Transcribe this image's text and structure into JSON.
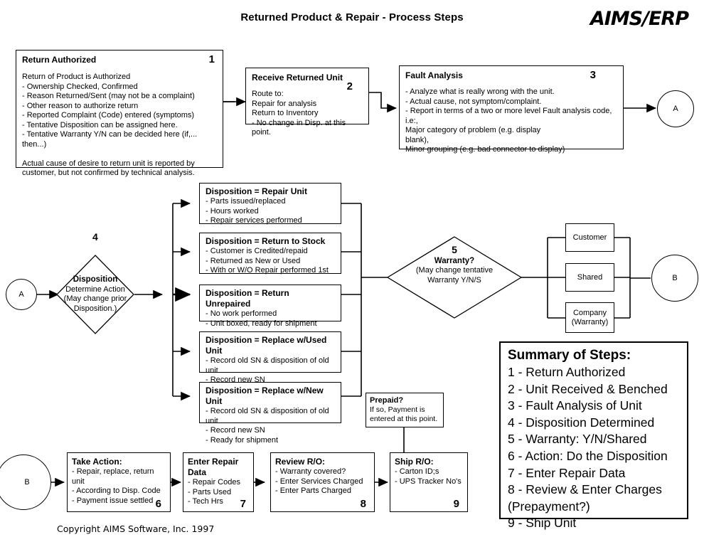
{
  "header": {
    "title": "Returned Product & Repair - Process Steps",
    "brand": "AIMS/ERP"
  },
  "footer": {
    "copyright": "Copyright AIMS Software, Inc. 1997"
  },
  "connectors": {
    "a_top": "A",
    "a_left": "A",
    "b_right": "B",
    "b_bottom": "B"
  },
  "steps": [
    {
      "id": "return-authorized",
      "num": "1",
      "title": "Return Authorized",
      "body": "Return of Product is Authorized\n- Ownership Checked, Confirmed\n- Reason Returned/Sent (may not be a complaint)\n- Other reason to authorize return\n- Reported Complaint (Code) entered (symptoms)\n- Tentative Disposition can be assigned here.\n- Tentative Warranty Y/N can be decided here (if,... then...)\n\nActual cause of desire to return unit is reported by\ncustomer, but not confirmed by technical analysis."
    },
    {
      "id": "receive-returned-unit",
      "num": "2",
      "title": "Receive Returned Unit",
      "body": "Route  to:\nRepair for analysis\nReturn to Inventory\n- No change in Disp. at this point."
    },
    {
      "id": "fault-analysis",
      "num": "3",
      "title": "Fault Analysis",
      "body": "- Analyze what is really wrong with the unit.\n- Actual cause, not symptom/complaint.\n- Report in terms of a two or more level Fault analysis code, i.e:,\n                    Major category of problem  (e.g. display\nblank),\n     Minor grouping (e.g. bad connector to display)"
    }
  ],
  "disposition_diamond": {
    "num": "4",
    "title": "Disposition",
    "line2": "Determine Action",
    "line3": "(May change prior",
    "line4": "Disposition.)"
  },
  "dispositions": [
    {
      "id": "disposition-repair-unit",
      "title": "Disposition = Repair Unit",
      "body": "- Parts issued/replaced\n- Hours worked\n- Repair services performed"
    },
    {
      "id": "disposition-return-to-stock",
      "title": "Disposition = Return to Stock",
      "body": "- Customer is Credited/repaid\n- Returned as New or Used\n- With or W/O Repair performed 1st"
    },
    {
      "id": "disposition-return-unrepaired",
      "title": "Disposition = Return Unrepaired",
      "body": "- No work performed\n- Unit boxed, ready for shipment"
    },
    {
      "id": "disposition-replace-used-unit",
      "title": "Disposition = Replace w/Used Unit",
      "body": "- Record old SN & disposition of old unit\n- Record new SN\n- Ready for shipment"
    },
    {
      "id": "disposition-replace-new-unit",
      "title": "Disposition = Replace w/New Unit",
      "body": "- Record old SN & disposition of old unit\n- Record new SN\n- Ready for shipment"
    }
  ],
  "warranty_diamond": {
    "num": "5",
    "title": "Warranty?",
    "line2": "(May change tentative",
    "line3": "Warranty Y/N/S"
  },
  "warranty_outcomes": [
    {
      "id": "outcome-customer",
      "label": "Customer"
    },
    {
      "id": "outcome-shared",
      "label": "Shared"
    },
    {
      "id": "outcome-company",
      "label": "Company\n(Warranty)"
    }
  ],
  "prepaid": {
    "title": "Prepaid?",
    "body": "If so, Payment is\nentered at this point."
  },
  "bottom_steps": [
    {
      "id": "take-action",
      "num": "6",
      "title": "Take Action:",
      "body": "- Repair, replace, return unit\n- According to Disp. Code\n-  Payment issue settled"
    },
    {
      "id": "enter-repair-data",
      "num": "7",
      "title": "Enter Repair Data",
      "body": "- Repair Codes\n- Parts Used\n- Tech Hrs"
    },
    {
      "id": "review-ro",
      "num": "8",
      "title": "Review R/O:",
      "body": "- Warranty covered?\n- Enter Services Charged\n- Enter Parts Charged"
    },
    {
      "id": "ship-ro",
      "num": "9",
      "title": "Ship R/O:",
      "body": "- Carton ID;s\n- UPS Tracker No's"
    }
  ],
  "summary": {
    "title": "Summary of Steps:",
    "items": [
      "1 - Return Authorized",
      "2 - Unit Received & Benched",
      "3 - Fault Analysis of Unit",
      "4 - Disposition Determined",
      "5 - Warranty: Y/N/Shared",
      "6 - Action: Do the Disposition",
      "7 - Enter Repair Data",
      "8 - Review & Enter Charges\n          (Prepayment?)",
      "9 - Ship Unit"
    ]
  },
  "colors": {
    "ink": "#000000",
    "paper": "#ffffff"
  }
}
